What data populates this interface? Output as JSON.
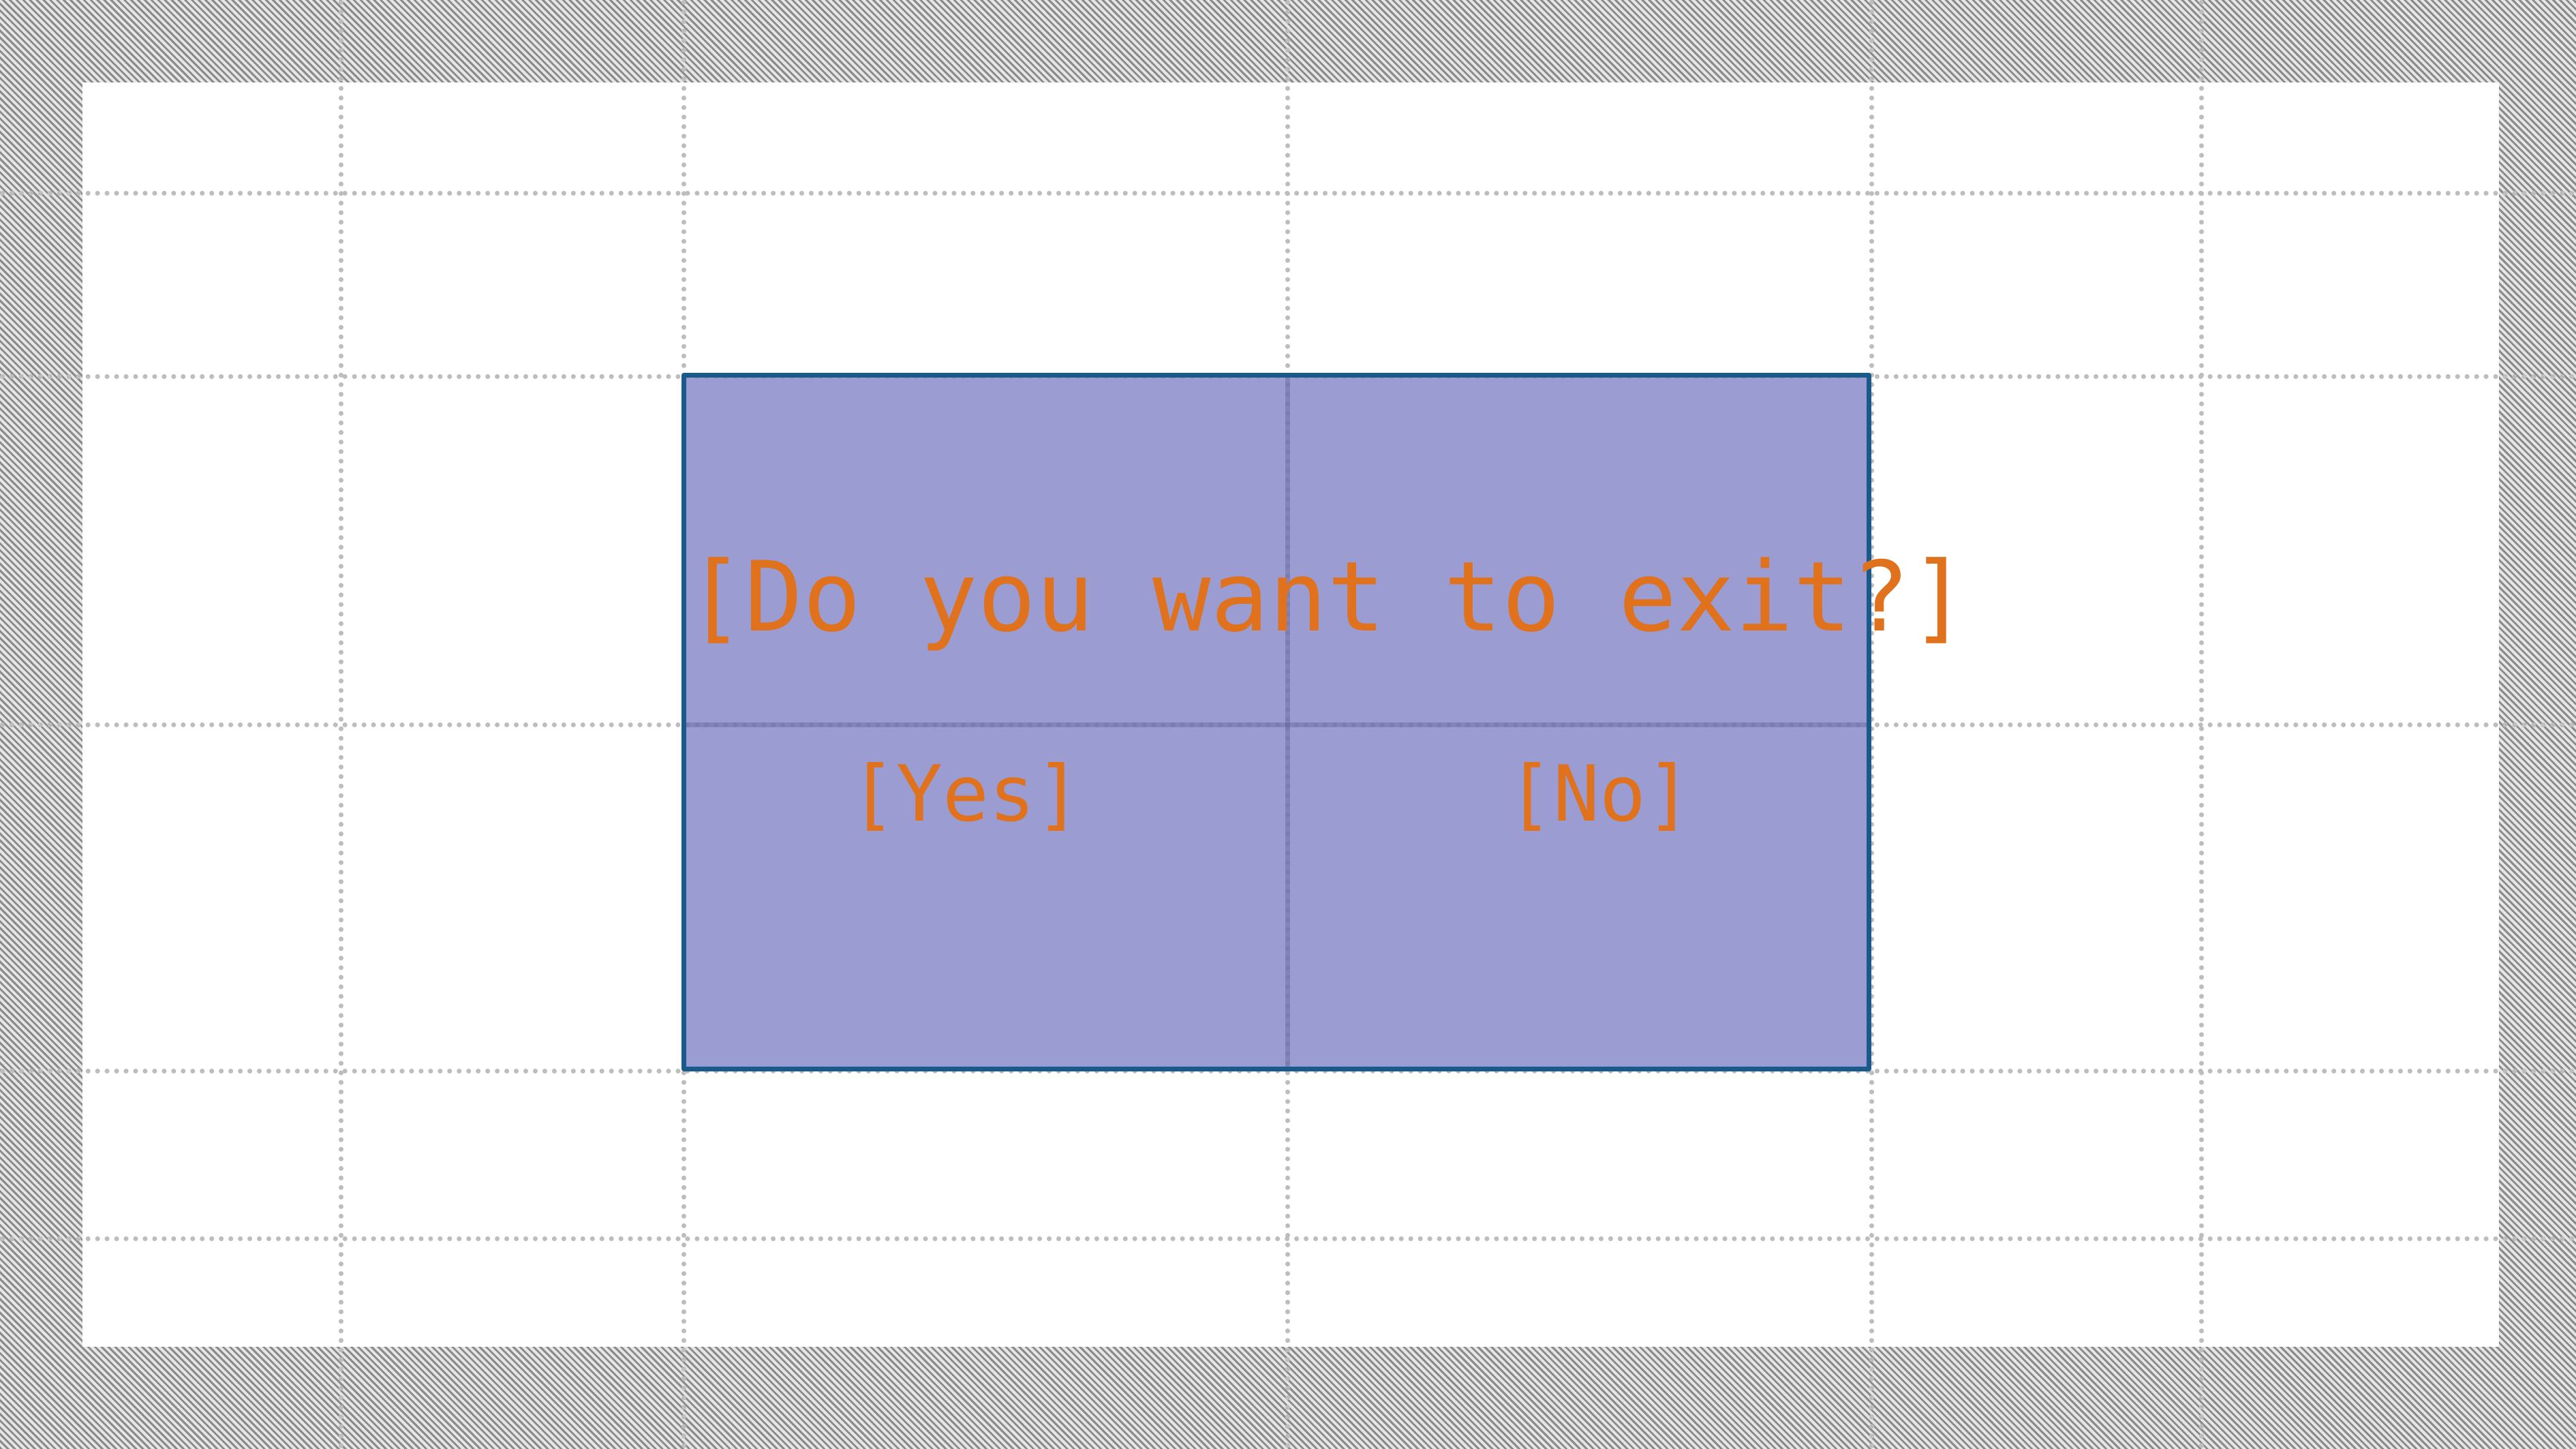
{
  "dialog": {
    "message": "[Do you want to exit?]",
    "yes_label": "[Yes]",
    "no_label": "[No]"
  },
  "colors": {
    "dialog_fill": "#8486c8",
    "dialog_border": "#1a5a8a",
    "text": "#e0721e",
    "grid": "#bdbdbd",
    "background_hatch": "#8a8a8a"
  }
}
